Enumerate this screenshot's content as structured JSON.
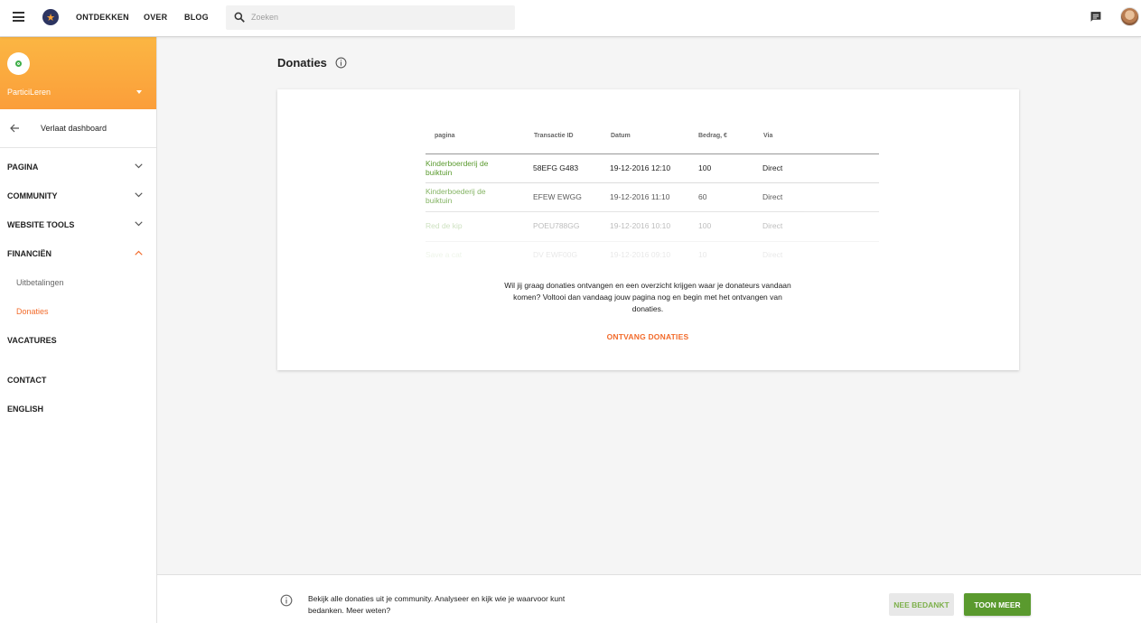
{
  "topbar": {
    "nav": [
      "ONTDEKKEN",
      "OVER",
      "BLOG"
    ],
    "search_placeholder": "Zoeken"
  },
  "sidebar": {
    "org_name": "ParticiLeren",
    "leave_label": "Verlaat dashboard",
    "items": [
      {
        "label": "PAGINA",
        "state": "collapsed"
      },
      {
        "label": "COMMUNITY",
        "state": "collapsed"
      },
      {
        "label": "WEBSITE TOOLS",
        "state": "collapsed"
      },
      {
        "label": "FINANCIËN",
        "state": "expanded"
      },
      {
        "label": "Uitbetalingen",
        "state": "sub"
      },
      {
        "label": "Donaties",
        "state": "sub-active"
      },
      {
        "label": "VACATURES"
      },
      {
        "label": "CONTACT"
      },
      {
        "label": "ENGLISH"
      }
    ]
  },
  "main": {
    "title": "Donaties",
    "table": {
      "headers": [
        "pagina",
        "Transactie ID",
        "Datum",
        "Bedrag, €",
        "Via"
      ],
      "rows": [
        [
          "Kinderboerderij de buiktuin",
          "58EFG G483",
          "19-12-2016 12:10",
          "100",
          "Direct"
        ],
        [
          "Kinderboederij de buiktuin",
          "EFEW EWGG",
          "19-12-2016 11:10",
          "60",
          "Direct"
        ],
        [
          "Red de kip",
          "POEU788GG",
          "19-12-2016 10:10",
          "100",
          "Direct"
        ],
        [
          "Save a cat",
          "DV EWF00G",
          "19-12-2016 09:10",
          "10",
          "Direct"
        ]
      ]
    },
    "message": "Wil jij graag donaties ontvangen en een overzicht krijgen waar je donateurs vandaan komen? Voltooi dan vandaag jouw pagina nog en begin met het ontvangen van donaties.",
    "cta": "ONTVANG DONATIES"
  },
  "banner": {
    "text": "Bekijk alle donaties uit je community. Analyseer en kijk wie je waarvoor kunt bedanken. Meer weten?",
    "no_label": "NEE BEDANKT",
    "more_label": "TOON MEER"
  },
  "colors": {
    "accent_orange": "#f26b2b",
    "brand_green": "#5a9a2e",
    "header_gradient_top": "#fbb643",
    "header_gradient_bottom": "#fb9e3a"
  }
}
